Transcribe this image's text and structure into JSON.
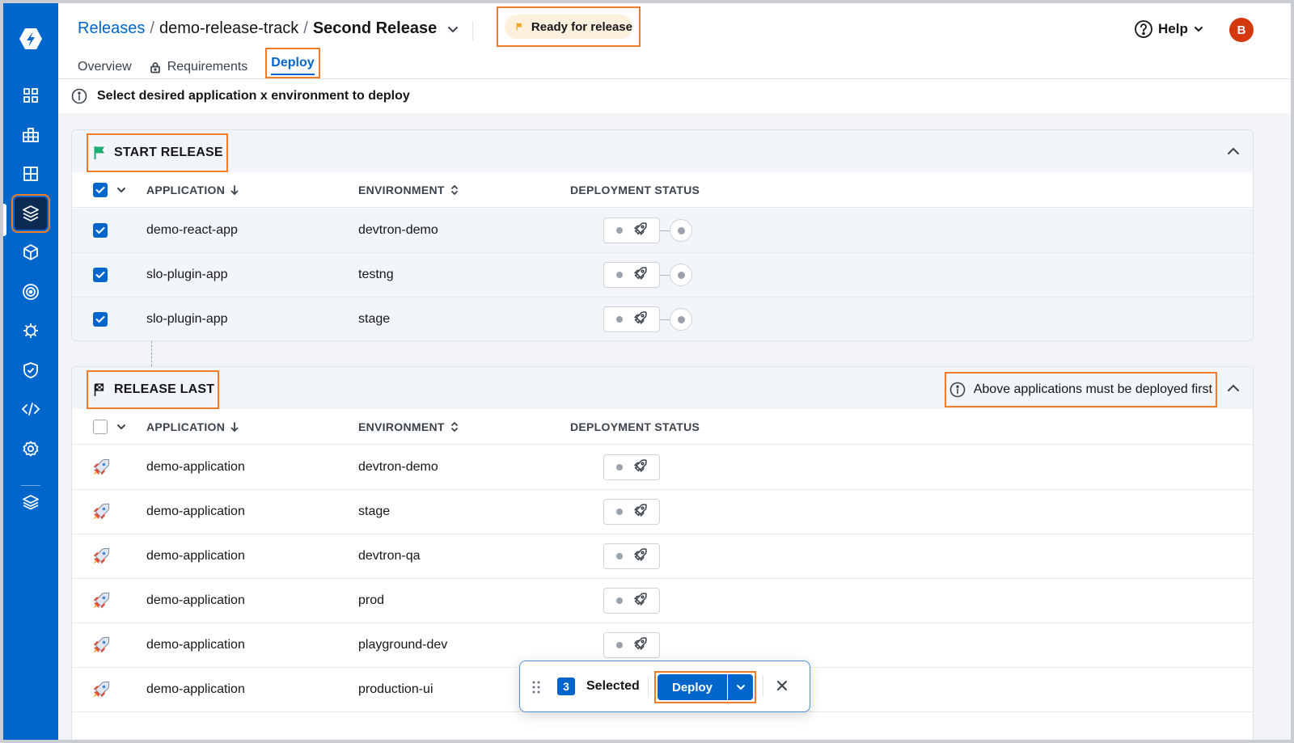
{
  "header": {
    "breadcrumb": {
      "releases": "Releases",
      "sep": "/",
      "track": "demo-release-track",
      "current": "Second Release"
    },
    "status": "Ready for release",
    "tabs": [
      {
        "label": "Overview"
      },
      {
        "label": "Requirements"
      },
      {
        "label": "Deploy"
      }
    ],
    "help": "Help",
    "avatar": "B"
  },
  "info": "Select desired application x environment to deploy",
  "columns": {
    "application": "APPLICATION",
    "environment": "ENVIRONMENT",
    "deployment_status": "DEPLOYMENT STATUS"
  },
  "groups": [
    {
      "title": "START RELEASE",
      "rows": [
        {
          "app": "demo-react-app",
          "env": "devtron-demo"
        },
        {
          "app": "slo-plugin-app",
          "env": "testng"
        },
        {
          "app": "slo-plugin-app",
          "env": "stage"
        }
      ]
    },
    {
      "title": "RELEASE LAST",
      "notice": "Above applications must be deployed first",
      "rows": [
        {
          "app": "demo-application",
          "env": "devtron-demo"
        },
        {
          "app": "demo-application",
          "env": "stage"
        },
        {
          "app": "demo-application",
          "env": "devtron-qa"
        },
        {
          "app": "demo-application",
          "env": "prod"
        },
        {
          "app": "demo-application",
          "env": "playground-dev"
        },
        {
          "app": "demo-application",
          "env": "production-ui"
        }
      ]
    }
  ],
  "actionbar": {
    "count": "3",
    "selected_label": "Selected",
    "deploy_label": "Deploy"
  },
  "colors": {
    "primary": "#0066cc",
    "sidebar": "#0066cc",
    "highlight": "#f07c28",
    "status_bg": "#fdf0dc",
    "flag_green": "#1dad70",
    "flag_orange": "#f5a623"
  }
}
